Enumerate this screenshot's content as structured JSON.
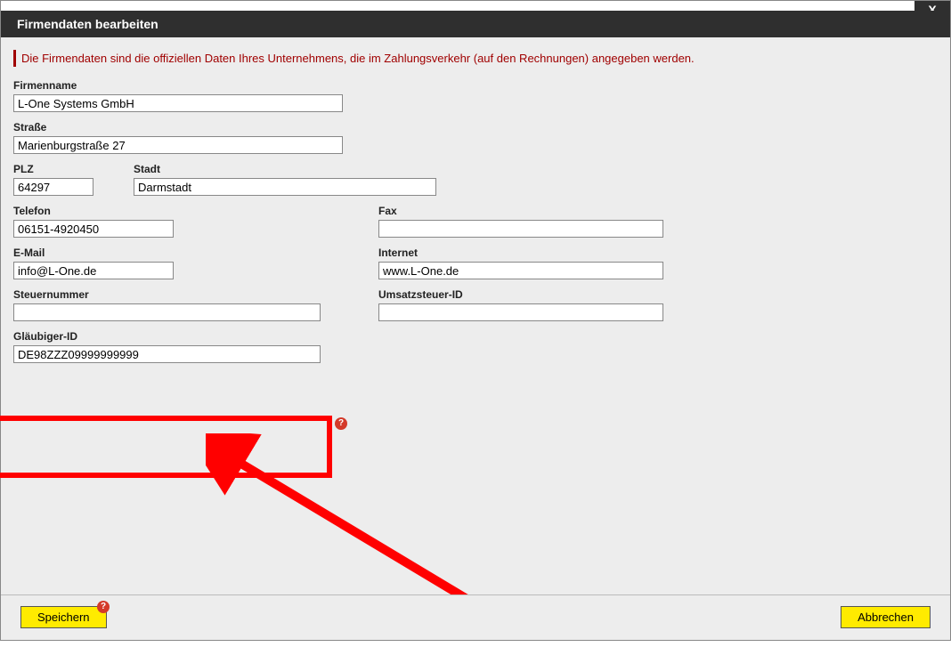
{
  "window": {
    "title": "Firmendaten bearbeiten",
    "close_label": "X"
  },
  "info": "Die Firmendaten sind die offiziellen Daten Ihres Unternehmens, die im Zahlungsverkehr (auf den Rechnungen) angegeben werden.",
  "labels": {
    "firmenname": "Firmenname",
    "strasse": "Straße",
    "plz": "PLZ",
    "stadt": "Stadt",
    "telefon": "Telefon",
    "fax": "Fax",
    "email": "E-Mail",
    "internet": "Internet",
    "steuernummer": "Steuernummer",
    "ustid": "Umsatzsteuer-ID",
    "glaeubigerid": "Gläubiger-ID"
  },
  "values": {
    "firmenname": "L-One Systems GmbH",
    "strasse": "Marienburgstraße 27",
    "plz": "64297",
    "stadt": "Darmstadt",
    "telefon": "06151-4920450",
    "fax": "",
    "email": "info@L-One.de",
    "internet": "www.L-One.de",
    "steuernummer": "",
    "ustid": "",
    "glaeubigerid": "DE98ZZZ09999999999"
  },
  "buttons": {
    "save": "Speichern",
    "cancel": "Abbrechen"
  },
  "help_glyph": "?"
}
